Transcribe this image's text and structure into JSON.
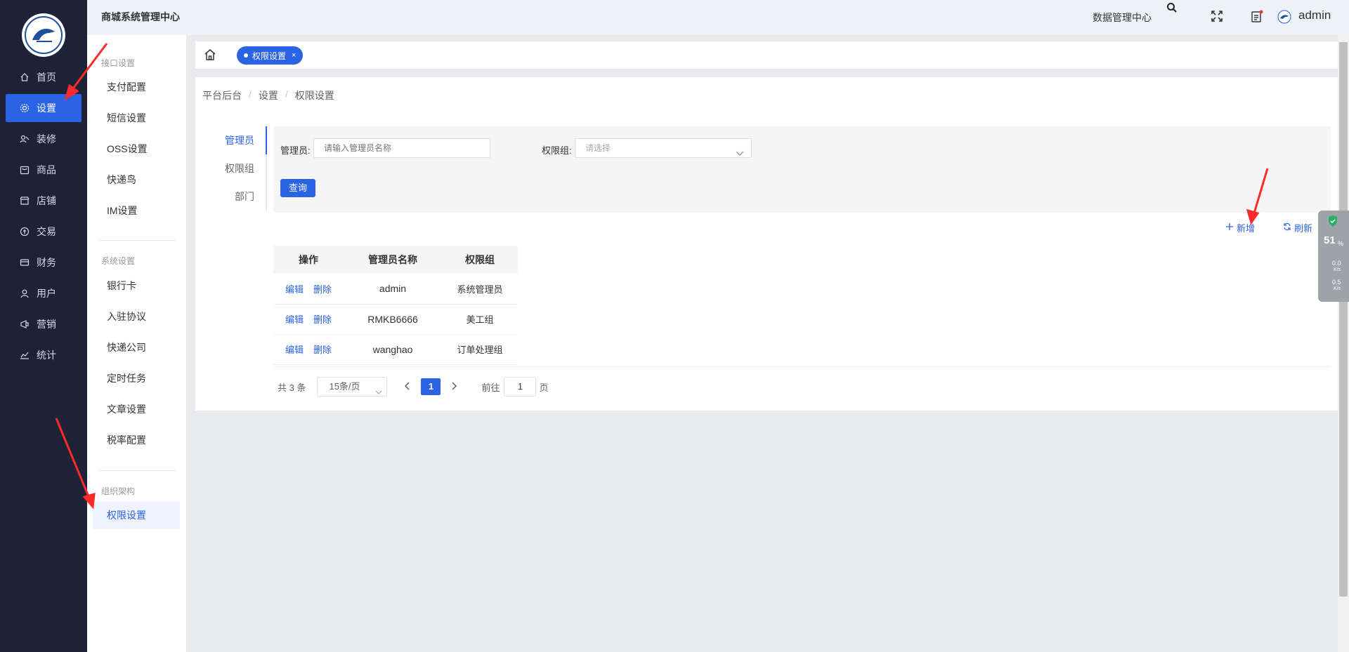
{
  "header": {
    "brand": "商城系统管理中心",
    "center_link": "数据管理中心",
    "user": "admin"
  },
  "sidebar": {
    "items": [
      {
        "label": "首页",
        "icon": "home-icon"
      },
      {
        "label": "设置",
        "icon": "gear-icon",
        "active": true
      },
      {
        "label": "装修",
        "icon": "decor-icon"
      },
      {
        "label": "商品",
        "icon": "goods-icon"
      },
      {
        "label": "店铺",
        "icon": "shop-icon"
      },
      {
        "label": "交易",
        "icon": "trade-icon"
      },
      {
        "label": "财务",
        "icon": "finance-icon"
      },
      {
        "label": "用户",
        "icon": "user-icon"
      },
      {
        "label": "营销",
        "icon": "marketing-icon"
      },
      {
        "label": "统计",
        "icon": "stats-icon"
      }
    ]
  },
  "subsidebar": {
    "group1": "接口设置",
    "group1_items": [
      "支付配置",
      "短信设置",
      "OSS设置",
      "快递鸟",
      "IM设置"
    ],
    "group2": "系统设置",
    "group2_items": [
      "银行卡",
      "入驻协议",
      "快递公司",
      "定时任务",
      "文章设置",
      "税率配置"
    ],
    "group3": "组织架构",
    "group3_items": [
      "权限设置"
    ]
  },
  "tabs": {
    "open_tab": "权限设置",
    "close": "×"
  },
  "breadcrumb": [
    "平台后台",
    "设置",
    "权限设置"
  ],
  "vtabs": [
    "管理员",
    "权限组",
    "部门"
  ],
  "filter": {
    "admin_label": "管理员:",
    "admin_placeholder": "请输入管理员名称",
    "group_label": "权限组:",
    "group_placeholder": "请选择",
    "query": "查询"
  },
  "actions": {
    "add": "新增",
    "refresh": "刷新"
  },
  "table": {
    "headers": [
      "操作",
      "管理员名称",
      "权限组"
    ],
    "edit": "编辑",
    "delete": "删除",
    "rows": [
      {
        "name": "admin",
        "group": "系统管理员"
      },
      {
        "name": "RMKB6666",
        "group": "美工组"
      },
      {
        "name": "wanghao",
        "group": "订单处理组"
      }
    ]
  },
  "pager": {
    "total": "共 3 条",
    "size": "15条/页",
    "current": "1",
    "goto_prefix": "前往",
    "goto_value": "1",
    "goto_suffix": "页"
  },
  "widget": {
    "percent": "51",
    "percent_unit": "%",
    "up": "0.0",
    "up_unit": "K/s",
    "down": "0.5",
    "down_unit": "K/s"
  }
}
